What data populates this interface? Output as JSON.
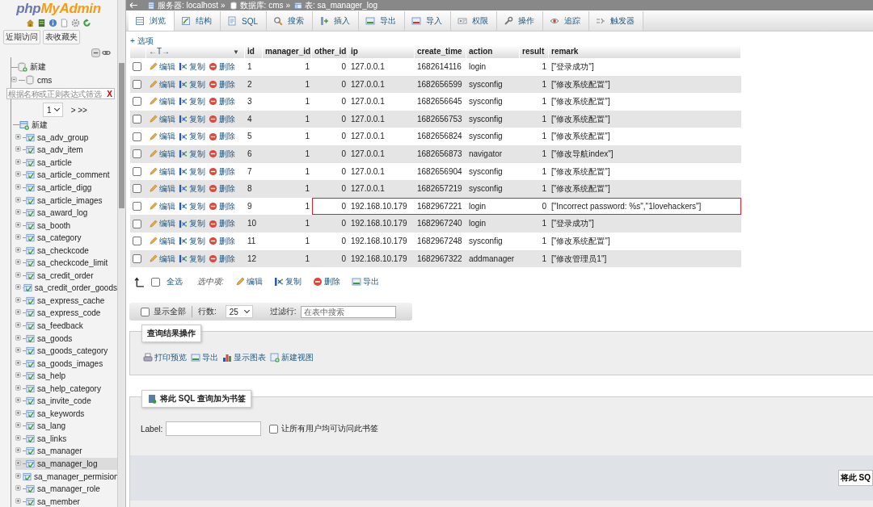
{
  "sidebar": {
    "logo": {
      "prefix": "php",
      "name": "MyAdmin"
    },
    "tabs": [
      {
        "label": "近期访问"
      },
      {
        "label": "表收藏夹"
      }
    ],
    "new_database": "新建",
    "database": {
      "name": "cms",
      "expanded": true,
      "filter_placeholder": "根据名称或正则表达式筛选",
      "filter_clear": "X",
      "page": "1",
      "page_next": "> >>",
      "new_table": "新建",
      "tables": [
        {
          "name": "sa_adv_group",
          "selected": false
        },
        {
          "name": "sa_adv_item",
          "selected": false
        },
        {
          "name": "sa_article",
          "selected": false
        },
        {
          "name": "sa_article_comment",
          "selected": false
        },
        {
          "name": "sa_article_digg",
          "selected": false
        },
        {
          "name": "sa_article_images",
          "selected": false
        },
        {
          "name": "sa_award_log",
          "selected": false
        },
        {
          "name": "sa_booth",
          "selected": false
        },
        {
          "name": "sa_category",
          "selected": false
        },
        {
          "name": "sa_checkcode",
          "selected": false
        },
        {
          "name": "sa_checkcode_limit",
          "selected": false
        },
        {
          "name": "sa_credit_order",
          "selected": false
        },
        {
          "name": "sa_credit_order_goods",
          "selected": false
        },
        {
          "name": "sa_express_cache",
          "selected": false
        },
        {
          "name": "sa_express_code",
          "selected": false
        },
        {
          "name": "sa_feedback",
          "selected": false
        },
        {
          "name": "sa_goods",
          "selected": false
        },
        {
          "name": "sa_goods_category",
          "selected": false
        },
        {
          "name": "sa_goods_images",
          "selected": false
        },
        {
          "name": "sa_help",
          "selected": false
        },
        {
          "name": "sa_help_category",
          "selected": false
        },
        {
          "name": "sa_invite_code",
          "selected": false
        },
        {
          "name": "sa_keywords",
          "selected": false
        },
        {
          "name": "sa_lang",
          "selected": false
        },
        {
          "name": "sa_links",
          "selected": false
        },
        {
          "name": "sa_manager",
          "selected": false
        },
        {
          "name": "sa_manager_log",
          "selected": true
        },
        {
          "name": "sa_manager_permision",
          "selected": false
        },
        {
          "name": "sa_manager_role",
          "selected": false
        },
        {
          "name": "sa_member",
          "selected": false
        }
      ]
    }
  },
  "breadcrumb": [
    {
      "label": "服务器: localhost",
      "separator": "»"
    },
    {
      "label": "数据库: cms",
      "separator": "»"
    },
    {
      "label": "表: sa_manager_log"
    }
  ],
  "tabs": [
    {
      "label": "浏览",
      "selected": true
    },
    {
      "label": "结构",
      "selected": false
    },
    {
      "label": "SQL",
      "selected": false
    },
    {
      "label": "搜索",
      "selected": false
    },
    {
      "label": "插入",
      "selected": false
    },
    {
      "label": "导出",
      "selected": false
    },
    {
      "label": "导入",
      "selected": false
    },
    {
      "label": "权限",
      "selected": false
    },
    {
      "label": "操作",
      "selected": false
    },
    {
      "label": "追踪",
      "selected": false
    },
    {
      "label": "触发器",
      "selected": false
    }
  ],
  "options_link": "+ 选项",
  "table": {
    "column_toggle": "←T→",
    "sort_marker": "▼",
    "columns": [
      "id",
      "manager_id",
      "other_id",
      "ip",
      "create_time",
      "action",
      "result",
      "remark"
    ],
    "rows": [
      {
        "checked": false,
        "annotated": false,
        "actions": [
          "编辑",
          "复制",
          "删除"
        ],
        "cells": [
          "1",
          "1",
          "0",
          "127.0.0.1",
          "1682614116",
          "login",
          "1",
          "[\"登录成功\"]"
        ]
      },
      {
        "checked": false,
        "annotated": false,
        "actions": [
          "编辑",
          "复制",
          "删除"
        ],
        "cells": [
          "2",
          "1",
          "0",
          "127.0.0.1",
          "1682656599",
          "sysconfig",
          "1",
          "[\"修改系统配置\"]"
        ]
      },
      {
        "checked": false,
        "annotated": false,
        "actions": [
          "编辑",
          "复制",
          "删除"
        ],
        "cells": [
          "3",
          "1",
          "0",
          "127.0.0.1",
          "1682656645",
          "sysconfig",
          "1",
          "[\"修改系统配置\"]"
        ]
      },
      {
        "checked": false,
        "annotated": false,
        "actions": [
          "编辑",
          "复制",
          "删除"
        ],
        "cells": [
          "4",
          "1",
          "0",
          "127.0.0.1",
          "1682656753",
          "sysconfig",
          "1",
          "[\"修改系统配置\"]"
        ]
      },
      {
        "checked": false,
        "annotated": false,
        "actions": [
          "编辑",
          "复制",
          "删除"
        ],
        "cells": [
          "5",
          "1",
          "0",
          "127.0.0.1",
          "1682656824",
          "sysconfig",
          "1",
          "[\"修改系统配置\"]"
        ]
      },
      {
        "checked": false,
        "annotated": false,
        "actions": [
          "编辑",
          "复制",
          "删除"
        ],
        "cells": [
          "6",
          "1",
          "0",
          "127.0.0.1",
          "1682656873",
          "navigator",
          "1",
          "[\"修改导航index\"]"
        ]
      },
      {
        "checked": false,
        "annotated": false,
        "actions": [
          "编辑",
          "复制",
          "删除"
        ],
        "cells": [
          "7",
          "1",
          "0",
          "127.0.0.1",
          "1682656904",
          "sysconfig",
          "1",
          "[\"修改系统配置\"]"
        ]
      },
      {
        "checked": false,
        "annotated": false,
        "actions": [
          "编辑",
          "复制",
          "删除"
        ],
        "cells": [
          "8",
          "1",
          "0",
          "127.0.0.1",
          "1682657219",
          "sysconfig",
          "1",
          "[\"修改系统配置\"]"
        ]
      },
      {
        "checked": false,
        "annotated": true,
        "actions": [
          "编辑",
          "复制",
          "删除"
        ],
        "cells": [
          "9",
          "1",
          "0",
          "192.168.10.179",
          "1682967221",
          "login",
          "0",
          "[\"Incorrect password: %s\",\"1lovehackers\"]"
        ]
      },
      {
        "checked": false,
        "annotated": false,
        "actions": [
          "编辑",
          "复制",
          "删除"
        ],
        "cells": [
          "10",
          "1",
          "0",
          "192.168.10.179",
          "1682967240",
          "login",
          "1",
          "[\"登录成功\"]"
        ]
      },
      {
        "checked": false,
        "annotated": false,
        "actions": [
          "编辑",
          "复制",
          "删除"
        ],
        "cells": [
          "11",
          "1",
          "0",
          "192.168.10.179",
          "1682967248",
          "sysconfig",
          "1",
          "[\"修改系统配置\"]"
        ]
      },
      {
        "checked": false,
        "annotated": false,
        "actions": [
          "编辑",
          "复制",
          "删除"
        ],
        "cells": [
          "12",
          "1",
          "0",
          "192.168.10.179",
          "1682967322",
          "addmanager",
          "1",
          "[\"修改管理员1\"]"
        ]
      }
    ]
  },
  "bulk": {
    "select_all": "全选",
    "select_all_checked": false,
    "with_selected": "选中项:",
    "actions": [
      "编辑",
      "复制",
      "删除",
      "导出"
    ]
  },
  "navigation": {
    "show_all": "显示全部",
    "show_all_checked": false,
    "rows_label": "行数:",
    "rows_value": "25",
    "filter_label": "过滤行:",
    "filter_placeholder": "在表中搜索"
  },
  "query_operations": {
    "legend": "查询结果操作",
    "links": [
      "打印预览",
      "导出",
      "显示图表",
      "新建视图"
    ]
  },
  "bookmark": {
    "legend": "将此 SQL 查询加为书签",
    "label_text": "Label:",
    "shared_label": "让所有用户均可访问此书签",
    "shared_checked": false,
    "submit": "将此 SQ"
  }
}
